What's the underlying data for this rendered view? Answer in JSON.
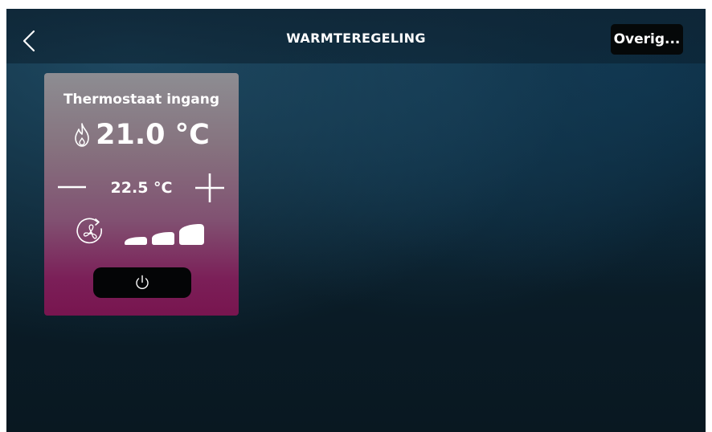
{
  "header": {
    "title": "WARMTEREGELING",
    "more_label": "Overig...",
    "back_icon": "chevron-left-icon"
  },
  "thermostat": {
    "name": "Thermostaat ingang",
    "current_temperature": "21.0 °C",
    "setpoint": "22.5 °C",
    "mode_icon": "flame-icon",
    "fan_icon": "fan-auto-icon",
    "fan_speed_levels": 3,
    "power_icon": "power-icon",
    "card_gradient": [
      "#8d8d92",
      "#78154f"
    ]
  },
  "colors": {
    "background": "#0b2230",
    "text": "#ffffff",
    "button_dark": "#050809"
  }
}
